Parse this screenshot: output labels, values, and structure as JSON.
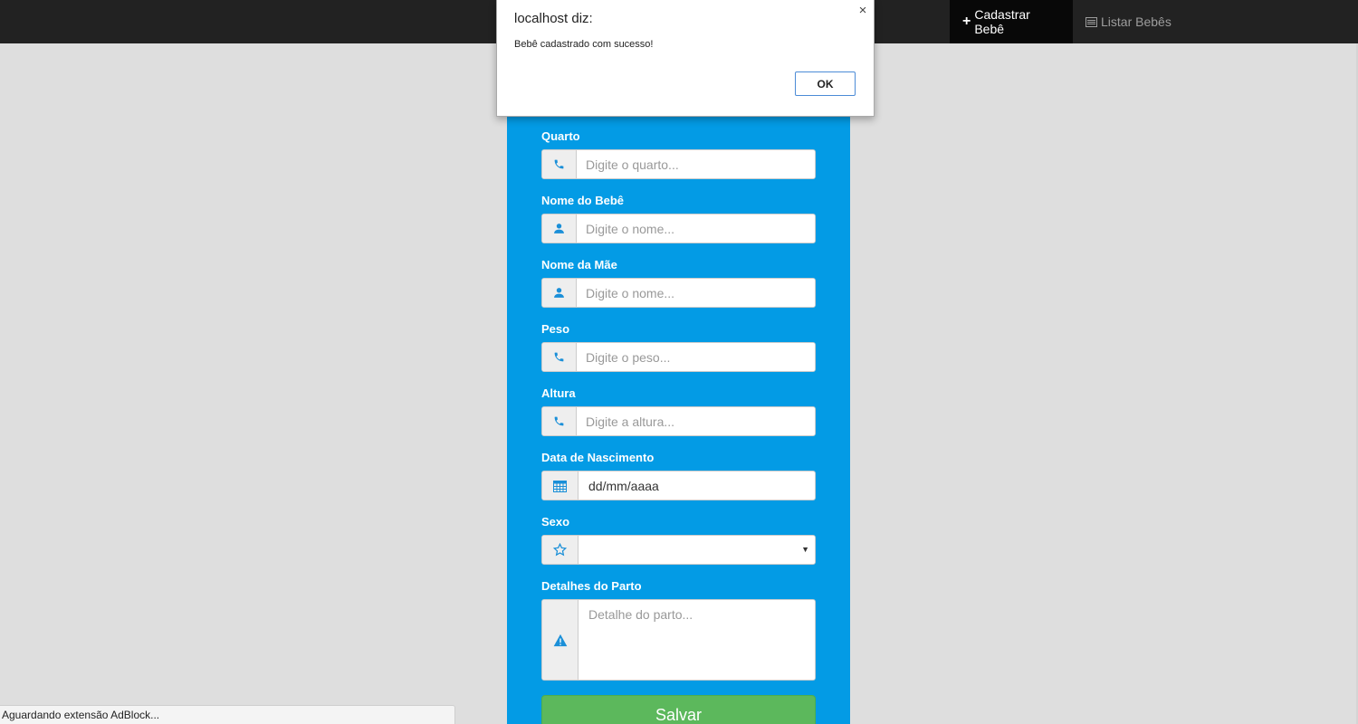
{
  "navbar": {
    "items": [
      {
        "label": "Cadastrar Bebê",
        "icon": "plus-icon",
        "active": true
      },
      {
        "label": "Listar Bebês",
        "icon": "list-icon",
        "active": false
      }
    ]
  },
  "dialog": {
    "title": "localhost diz:",
    "message": "Bebê cadastrado com sucesso!",
    "ok_label": "OK",
    "close_glyph": "×"
  },
  "form": {
    "fields": [
      {
        "label": "Quarto",
        "placeholder": "Digite o quarto...",
        "icon": "phone-icon"
      },
      {
        "label": "Nome do Bebê",
        "placeholder": "Digite o nome...",
        "icon": "user-icon"
      },
      {
        "label": "Nome da Mãe",
        "placeholder": "Digite o nome...",
        "icon": "user-icon"
      },
      {
        "label": "Peso",
        "placeholder": "Digite o peso...",
        "icon": "phone-icon"
      },
      {
        "label": "Altura",
        "placeholder": "Digite a altura...",
        "icon": "phone-icon"
      }
    ],
    "birth_date": {
      "label": "Data de Nascimento",
      "value": "dd/mm/aaaa",
      "icon": "calendar-icon"
    },
    "sex": {
      "label": "Sexo",
      "value": "",
      "icon": "star-icon"
    },
    "details": {
      "label": "Detalhes do Parto",
      "placeholder": "Detalhe do parto...",
      "icon": "warning-icon"
    },
    "save_label": "Salvar"
  },
  "status_bar": {
    "text": "Aguardando extensão AdBlock..."
  },
  "colors": {
    "navbar": "#222222",
    "panel": "#039be5",
    "accent_icon": "#1a8fd8",
    "save_button": "#5cb85c",
    "background": "#dedede"
  }
}
